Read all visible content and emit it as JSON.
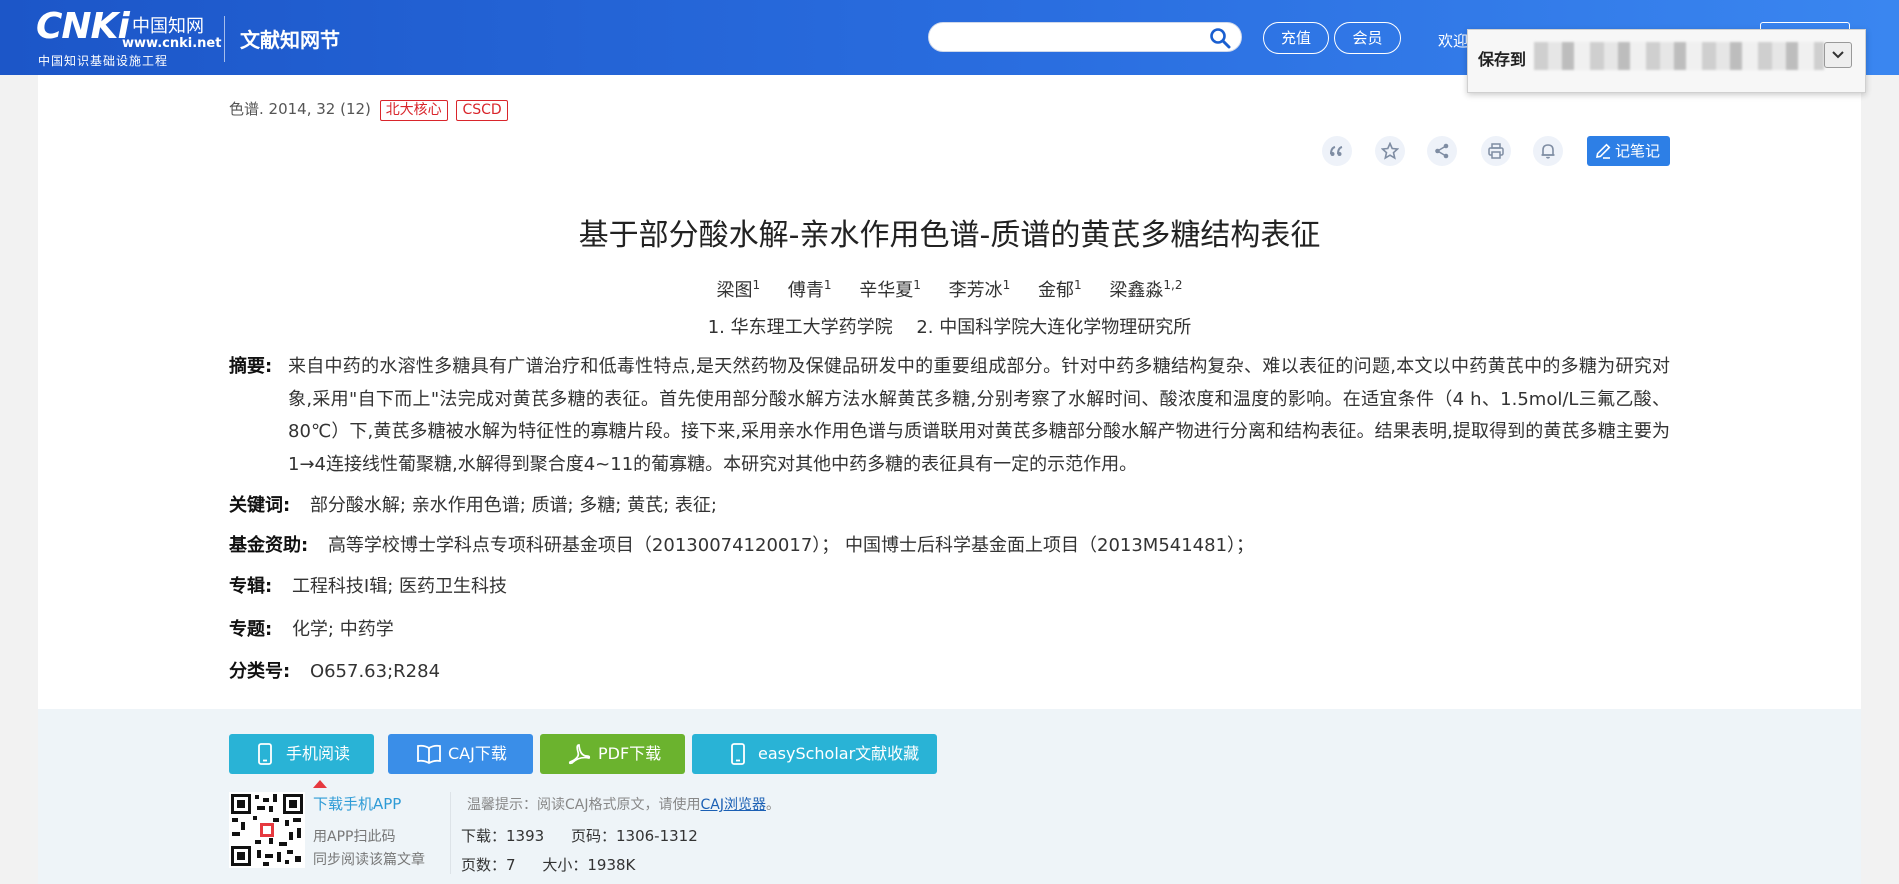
{
  "header": {
    "logo_main": "CNKi",
    "logo_cn": "中国知网",
    "logo_url": "www.cnki.net",
    "logo_sub": "中国知识基础设施工程",
    "site_name": "文献知网节",
    "search_placeholder": "",
    "recharge_label": "充值",
    "member_label": "会员",
    "welcome": "欢迎"
  },
  "save_popup": {
    "label": "保存到"
  },
  "article": {
    "source": "色谱. 2014, 32 (12)",
    "tags": [
      "北大核心",
      "CSCD"
    ],
    "note_label": "记笔记",
    "title": "基于部分酸水解-亲水作用色谱-质谱的黄芪多糖结构表征",
    "authors": [
      {
        "name": "梁图",
        "sup": "1"
      },
      {
        "name": "傅青",
        "sup": "1"
      },
      {
        "name": "辛华夏",
        "sup": "1"
      },
      {
        "name": "李芳冰",
        "sup": "1"
      },
      {
        "name": "金郁",
        "sup": "1"
      },
      {
        "name": "梁鑫淼",
        "sup": "1,2"
      }
    ],
    "orgs": [
      "1. 华东理工大学药学院",
      "2. 中国科学院大连化学物理研究所"
    ],
    "abstract_label": "摘要:",
    "abstract": "来自中药的水溶性多糖具有广谱治疗和低毒性特点,是天然药物及保健品研发中的重要组成部分。针对中药多糖结构复杂、难以表征的问题,本文以中药黄芪中的多糖为研究对象,采用\"自下而上\"法完成对黄芪多糖的表征。首先使用部分酸水解方法水解黄芪多糖,分别考察了水解时间、酸浓度和温度的影响。在适宜条件（4 h、1.5mol/L三氟乙酸、80℃）下,黄芪多糖被水解为特征性的寡糖片段。接下来,采用亲水作用色谱与质谱联用对黄芪多糖部分酸水解产物进行分离和结构表征。结果表明,提取得到的黄芪多糖主要为1→4连接线性葡聚糖,水解得到聚合度4~11的葡寡糖。本研究对其他中药多糖的表征具有一定的示范作用。",
    "keywords_label": "关键词:",
    "keywords": "部分酸水解; 亲水作用色谱; 质谱; 多糖; 黄芪; 表征;",
    "fund_label": "基金资助:",
    "fund": "高等学校博士学科点专项科研基金项目（20130074120017）；  中国博士后科学基金面上项目（2013M541481）；",
    "album_label": "专辑:",
    "album": "工程科技Ⅰ辑; 医药卫生科技",
    "topic_label": "专题:",
    "topic": "化学; 中药学",
    "class_label": "分类号:",
    "class": "O657.63;R284"
  },
  "downloads": {
    "mobile": "手机阅读",
    "caj": "CAJ下载",
    "pdf": "PDF下载",
    "easy": "easyScholar文献收藏",
    "app_link": "下载手机APP",
    "app_hint1": "用APP扫此码",
    "app_hint2": "同步阅读该篇文章",
    "tip_prefix": "温馨提示：阅读CAJ格式原文，请使用",
    "tip_link": "CAJ浏览器",
    "tip_suffix": "。",
    "downloads_label": "下载：",
    "downloads_value": "1393",
    "pages_label": "页码：",
    "pages_value": "1306-1312",
    "pagecount_label": "页数：",
    "pagecount_value": "7",
    "size_label": "大小：",
    "size_value": "1938K"
  },
  "colors": {
    "header_blue": "#2a6ee0",
    "tag_red": "#d9252b",
    "btn_teal": "#29b3d6",
    "btn_blue": "#3a8ee8",
    "btn_green": "#6bb32e",
    "note_blue": "#2d7fe6"
  }
}
